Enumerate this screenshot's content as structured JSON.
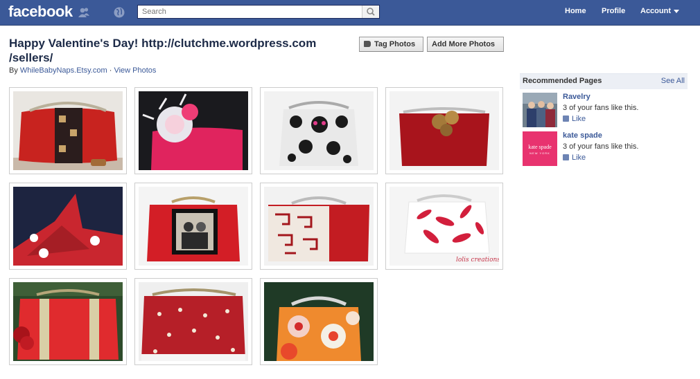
{
  "topbar": {
    "logo": "facebook",
    "search_placeholder": "Search",
    "nav": {
      "home": "Home",
      "profile": "Profile",
      "account": "Account"
    },
    "colors": {
      "bar": "#3b5998",
      "link": "#3b5998"
    }
  },
  "album": {
    "title_line1": "Happy Valentine's Day! http://clutchme.wordpress.com",
    "title_line2": "/sellers/",
    "by_label": "By",
    "author": "WhileBabyNaps.Etsy.com",
    "separator": "·",
    "view_photos": "View Photos",
    "tag_button": "Tag Photos",
    "add_button": "Add More Photos"
  },
  "photos": [
    {
      "alt": "red clutch with skull print band"
    },
    {
      "alt": "pink clutch with feather flower"
    },
    {
      "alt": "black and white sugar skull clutch"
    },
    {
      "alt": "red clutch with fabric roses"
    },
    {
      "alt": "navy clutch with red origami crane"
    },
    {
      "alt": "red clutch with vintage portrait photo"
    },
    {
      "alt": "red clutch with geometric white band"
    },
    {
      "alt": "white clutch with red leaves",
      "watermark": "lolis creations"
    },
    {
      "alt": "red patent clutch with studs"
    },
    {
      "alt": "red cherry print clutch"
    },
    {
      "alt": "retro flower print clutch"
    }
  ],
  "sidebar": {
    "heading": "Recommended Pages",
    "see_all": "See All",
    "pages": [
      {
        "name": "Ravelry",
        "fans": "3 of your fans like this.",
        "like": "Like",
        "icon": "ravelry-photo"
      },
      {
        "name": "kate spade",
        "fans": "3 of your fans like this.",
        "like": "Like",
        "icon": "kate-spade-logo",
        "logo_text": "kate spade",
        "logo_sub": "NEW YORK"
      }
    ]
  }
}
